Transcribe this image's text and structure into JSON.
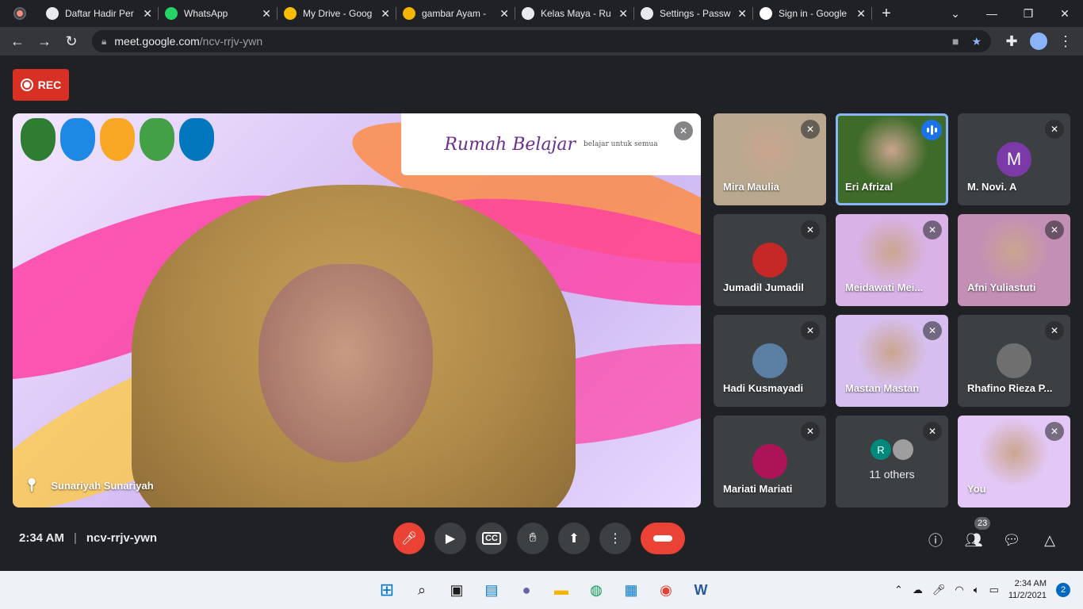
{
  "browser": {
    "tabs": [
      {
        "title": "Daftar Hadir Per",
        "icon": "globe-icon",
        "color": "#e8eaed"
      },
      {
        "title": "WhatsApp",
        "icon": "whatsapp-icon",
        "color": "#25d366"
      },
      {
        "title": "My Drive - Goog",
        "icon": "drive-icon",
        "color": "#fbbc04"
      },
      {
        "title": "gambar Ayam -",
        "icon": "slides-icon",
        "color": "#f4b400"
      },
      {
        "title": "Kelas Maya - Ru",
        "icon": "globe-icon",
        "color": "#e8eaed"
      },
      {
        "title": "Settings - Passw",
        "icon": "gear-icon",
        "color": "#e8eaed"
      },
      {
        "title": "Sign in - Google",
        "icon": "google-icon",
        "color": "#ffffff"
      }
    ],
    "url_host": "meet.google.com",
    "url_path": "/ncv-rrjv-ywn"
  },
  "meet": {
    "rec_label": "REC",
    "main_speaker": "Sunariyah Sunariyah",
    "banner_text": "Rumah Belajar",
    "banner_sub": "belajar untuk semua",
    "participants": [
      {
        "name": "Mira Maulia",
        "kind": "video",
        "bg": "#b9a88f"
      },
      {
        "name": "Eri Afrizal",
        "kind": "video",
        "bg": "#3f6b2a",
        "speaking": true
      },
      {
        "name": "M. Novi. A",
        "kind": "initial",
        "initial": "M",
        "bg": "#7b3aa8"
      },
      {
        "name": "Jumadil Jumadil",
        "kind": "avatar",
        "bg": "#c62828"
      },
      {
        "name": "Meidawati Mei...",
        "kind": "video",
        "bg": "#d9b3e8"
      },
      {
        "name": "Afni Yuliastuti",
        "kind": "video",
        "bg": "#c48fb5"
      },
      {
        "name": "Hadi Kusmayadi",
        "kind": "avatar",
        "bg": "#5b7fa3"
      },
      {
        "name": "Mastan Mastan",
        "kind": "video",
        "bg": "#d6bff0"
      },
      {
        "name": "Rhafino Rieza P...",
        "kind": "avatar",
        "bg": "#6f6f6f"
      },
      {
        "name": "Mariati Mariati",
        "kind": "avatar",
        "bg": "#ad1457"
      },
      {
        "name": "11 others",
        "kind": "others",
        "initial": "R",
        "bg": "#00897b"
      },
      {
        "name": "You",
        "kind": "video",
        "bg": "#e3c8f7"
      }
    ],
    "time": "2:34 AM",
    "meeting_code": "ncv-rrjv-ywn",
    "participant_count": "23"
  },
  "taskbar": {
    "time": "2:34 AM",
    "date": "11/2/2021",
    "notifications": "2"
  }
}
